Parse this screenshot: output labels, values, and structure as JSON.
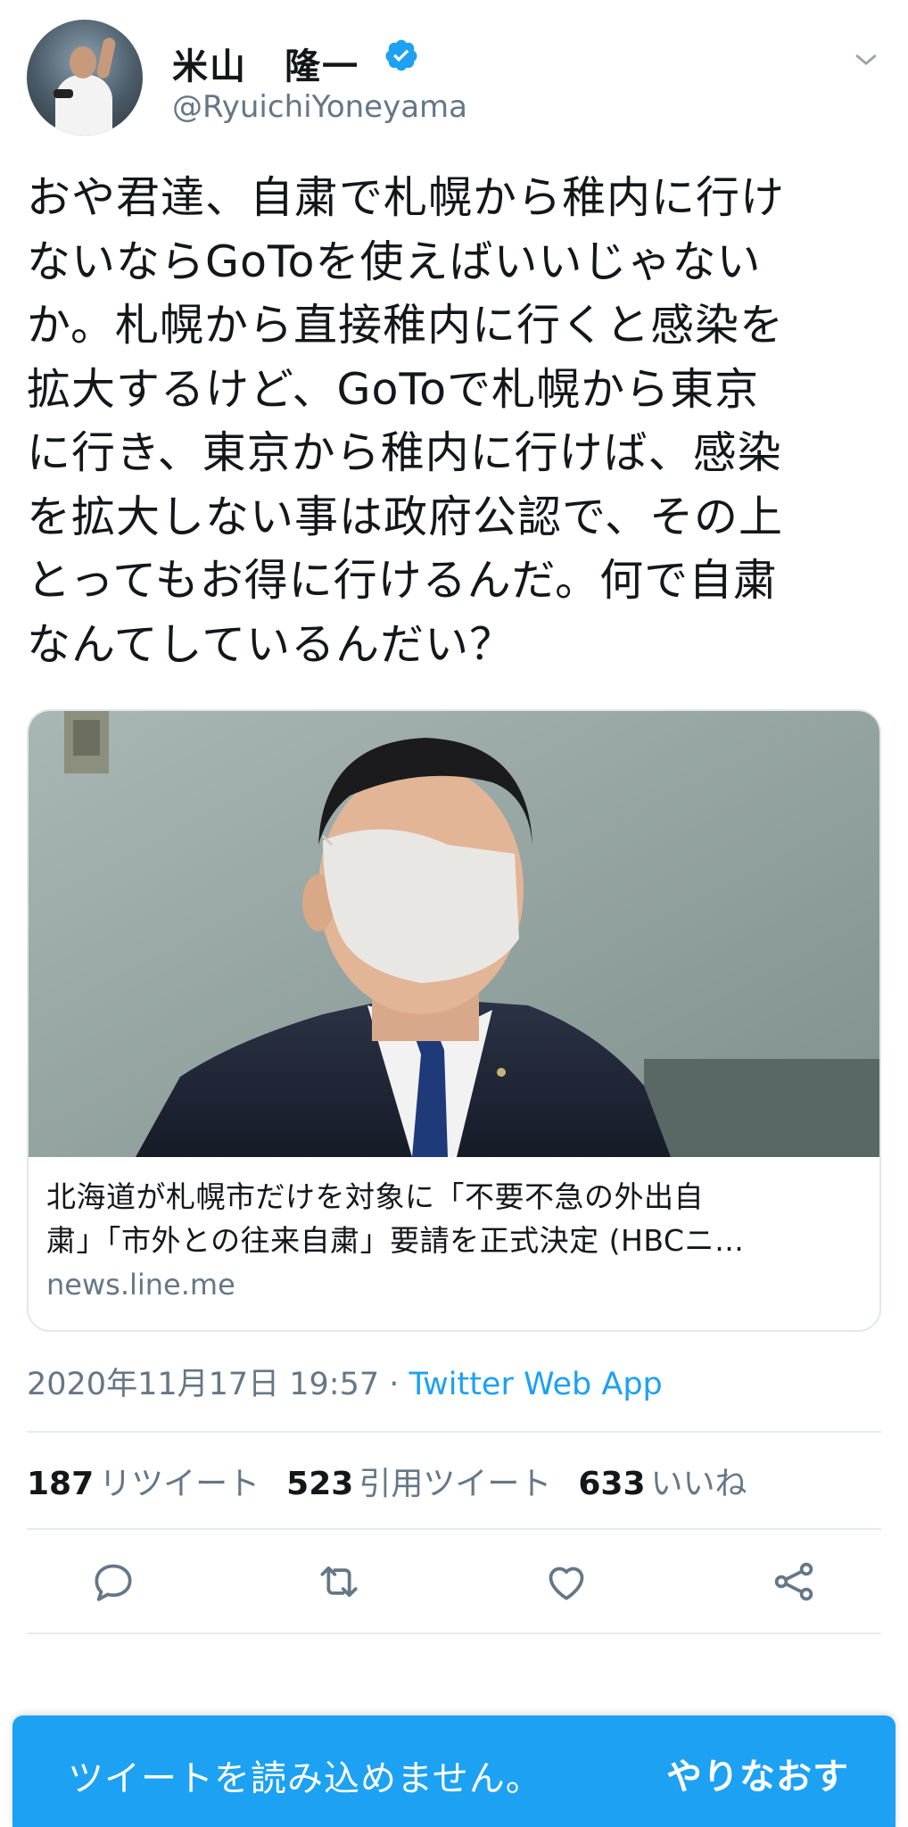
{
  "tweet": {
    "display_name": "米山　隆一",
    "handle": "@RyuichiYoneyama",
    "verified": true,
    "text_lines": [
      "おや君達、自粛で札幌から稚内に行け",
      "ないならGoToを使えばいいじゃない",
      "か。札幌から直接稚内に行くと感染を",
      "拡大するけど、GoToで札幌から東京",
      "に行き、東京から稚内に行けば、感染",
      "を拡大しない事は政府公認で、その上",
      "とってもお得に行けるんだ。何で自粛",
      "なんてしているんだい？"
    ],
    "timestamp": "2020年11月17日 19:57",
    "separator": " · ",
    "via_app": "Twitter Web App"
  },
  "link_card": {
    "title_lines": [
      "北海道が札幌市だけを対象に「不要不急の外出自",
      "粛」「市外との往来自粛」要請を正式決定 (HBCニ…"
    ],
    "domain": "news.line.me"
  },
  "stats": {
    "retweets_count": "187",
    "retweets_label": "リツイート",
    "quotes_count": "523",
    "quotes_label": "引用ツイート",
    "likes_count": "633",
    "likes_label": "いいね"
  },
  "actions": {
    "icons": [
      "reply-icon",
      "retweet-icon",
      "like-icon",
      "share-icon"
    ]
  },
  "toast": {
    "message": "ツイートを読み込めません。",
    "retry_label": "やりなおす"
  },
  "colors": {
    "accent": "#1da1f2",
    "text": "#14171a",
    "secondary": "#657786",
    "border": "#e1e8ed"
  }
}
